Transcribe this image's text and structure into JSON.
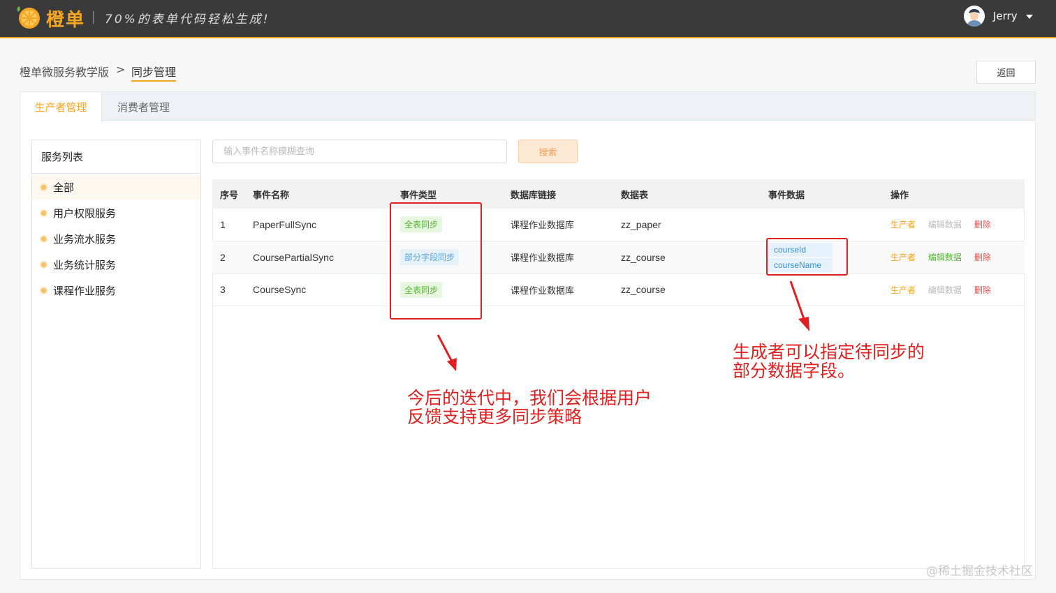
{
  "header": {
    "brand": "橙单",
    "slogan": "70%的表单代码轻松生成!",
    "username": "Jerry"
  },
  "breadcrumb": {
    "parent": "橙单微服务教学版",
    "separator": ">",
    "current": "同步管理"
  },
  "back_button": "返回",
  "tabs": [
    {
      "label": "生产者管理",
      "active": true
    },
    {
      "label": "消费者管理",
      "active": false
    }
  ],
  "service_list": {
    "title": "服务列表",
    "items": [
      {
        "label": "全部",
        "selected": true
      },
      {
        "label": "用户权限服务",
        "selected": false
      },
      {
        "label": "业务流水服务",
        "selected": false
      },
      {
        "label": "业务统计服务",
        "selected": false
      },
      {
        "label": "课程作业服务",
        "selected": false
      }
    ]
  },
  "search": {
    "placeholder": "输入事件名称模糊查询",
    "button": "搜索"
  },
  "table": {
    "columns": [
      "序号",
      "事件名称",
      "事件类型",
      "数据库链接",
      "数据表",
      "事件数据",
      "操作"
    ],
    "rows": [
      {
        "index": "1",
        "name": "PaperFullSync",
        "type": "全表同步",
        "type_color": "green",
        "db": "课程作业数据库",
        "table": "zz_paper",
        "fields": [],
        "ops": {
          "producer": "生产者",
          "edit": "编辑数据",
          "edit_enabled": false,
          "delete": "删除"
        }
      },
      {
        "index": "2",
        "name": "CoursePartialSync",
        "type": "部分字段同步",
        "type_color": "blue",
        "db": "课程作业数据库",
        "table": "zz_course",
        "fields": [
          "courseId",
          "courseName"
        ],
        "ops": {
          "producer": "生产者",
          "edit": "编辑数据",
          "edit_enabled": true,
          "delete": "删除"
        }
      },
      {
        "index": "3",
        "name": "CourseSync",
        "type": "全表同步",
        "type_color": "green",
        "db": "课程作业数据库",
        "table": "zz_course",
        "fields": [],
        "ops": {
          "producer": "生产者",
          "edit": "编辑数据",
          "edit_enabled": false,
          "delete": "删除"
        }
      }
    ]
  },
  "annotations": {
    "left": [
      "今后的迭代中，我们会根据用户",
      "反馈支持更多同步策略"
    ],
    "right": [
      "生成者可以指定待同步的",
      "部分数据字段。"
    ]
  },
  "watermark": "@稀土掘金技术社区",
  "colors": {
    "accent": "#f5a623",
    "topbar": "#3a3a3a",
    "annotation": "#e02020",
    "tag_green": "#55b630",
    "tag_blue": "#58a6db",
    "danger": "#e05555"
  }
}
